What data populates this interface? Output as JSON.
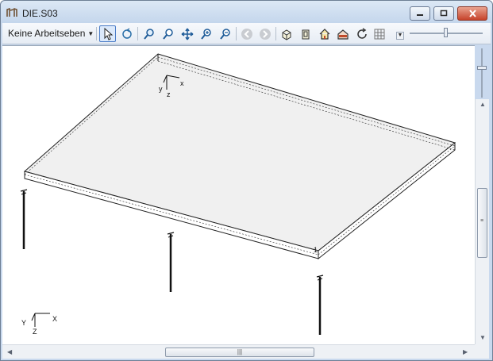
{
  "window": {
    "title": "DIE.S03"
  },
  "toolbar": {
    "workplane_label": "Keine Arbeitseben",
    "tools": [
      "select-arrow-icon",
      "rotate-view-icon",
      "zoom-window-icon",
      "zoom-icon",
      "pan-icon",
      "zoom-in-icon",
      "zoom-out-icon",
      "back-icon",
      "forward-icon",
      "view-iso-icon",
      "view-front-icon",
      "home-icon",
      "house-section-icon",
      "refresh-icon",
      "grid-icon"
    ]
  },
  "viewport": {
    "axis_top": {
      "x": "x",
      "y": "y",
      "z": "z"
    },
    "axis_bottom": {
      "x": "X",
      "y": "Y",
      "z": "Z"
    },
    "node_label": "1"
  },
  "scrollbars": {
    "grip": "|||"
  },
  "colors": {
    "title_bg": "#c4d6ec",
    "toolbar_bg": "#e6ecf4",
    "active_tool": "#dbe9fb",
    "close_button": "#c6432b"
  }
}
